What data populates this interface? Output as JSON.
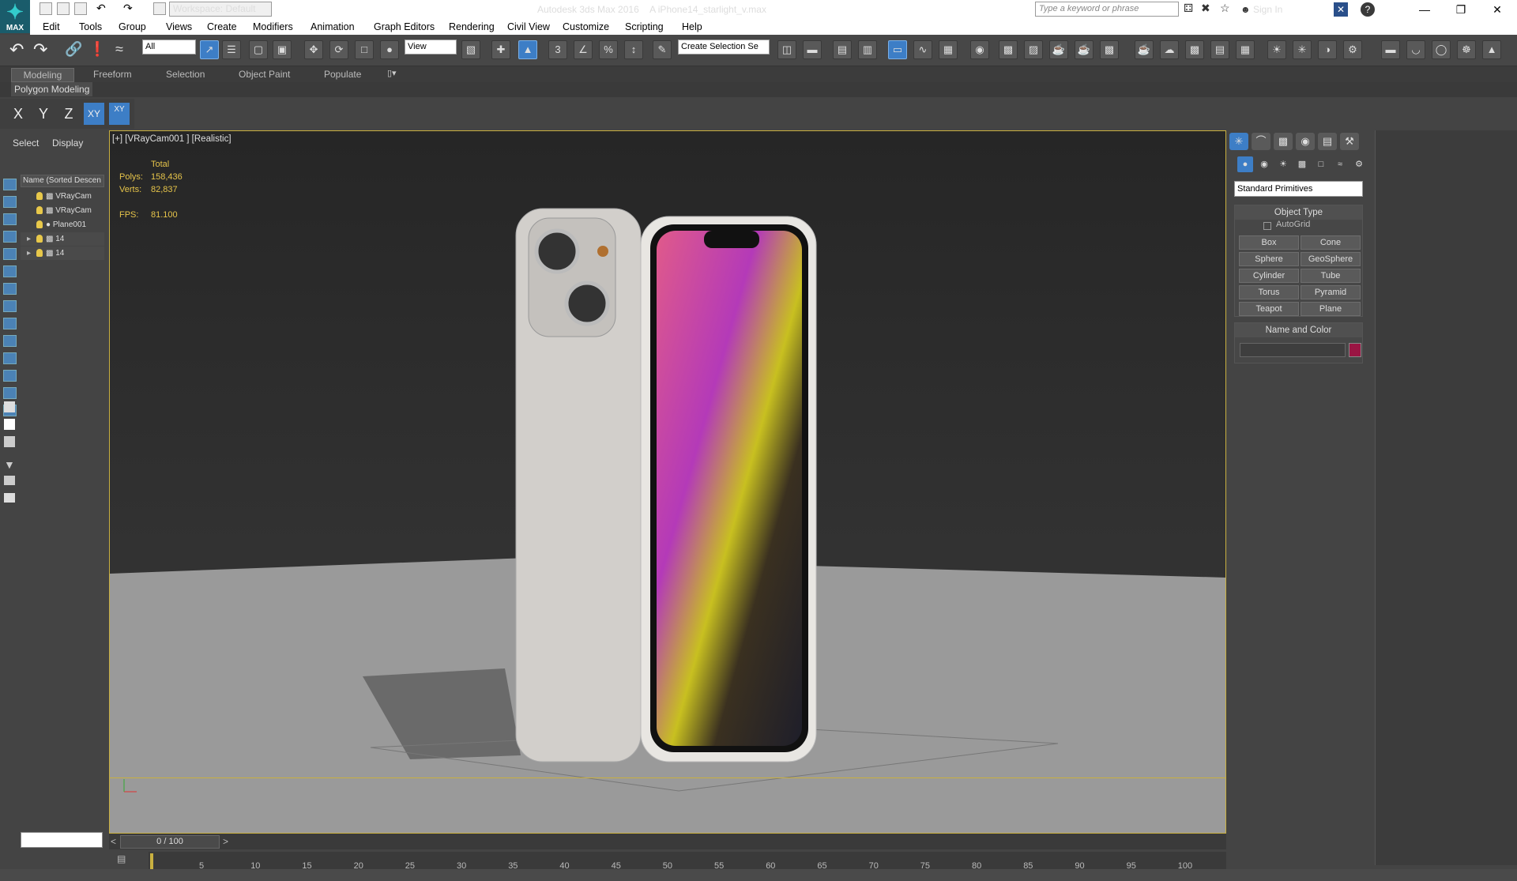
{
  "titlebar": {
    "logo_label": "MAX",
    "workspace": "Workspace: Default",
    "window_title": "Autodesk 3ds Max 2016",
    "file_name": "A iPhone14_starlight_v.max",
    "search_placeholder": "Type a keyword or phrase",
    "sign_in": "Sign In"
  },
  "menu": [
    "Edit",
    "Tools",
    "Group",
    "Views",
    "Create",
    "Modifiers",
    "Animation",
    "Graph Editors",
    "Rendering",
    "Civil View",
    "Customize",
    "Scripting",
    "Help"
  ],
  "toolbar": {
    "selection_filter": "All",
    "ref_coord": "View",
    "named_selection": "Create Selection Se"
  },
  "ribbon": {
    "tabs": [
      "Modeling",
      "Freeform",
      "Selection",
      "Object Paint",
      "Populate"
    ],
    "panel": "Polygon Modeling"
  },
  "axis_constraints": [
    "X",
    "Y",
    "Z",
    "XY",
    "XY"
  ],
  "explorer": {
    "tabs": [
      "Select",
      "Display"
    ],
    "column": "Name (Sorted Descen",
    "rows": [
      "VRayCam",
      "VRayCam",
      "Plane001",
      "14",
      "14"
    ]
  },
  "viewport": {
    "label": "[+] [VRayCam001 ] [Realistic]",
    "stats_header": "Total",
    "polys_label": "Polys:",
    "polys_value": "158,436",
    "verts_label": "Verts:",
    "verts_value": "82,837",
    "fps_label": "FPS:",
    "fps_value": "81.100"
  },
  "command_panel": {
    "primitive_type": "Standard Primitives",
    "object_type": "Object Type",
    "autogrid": "AutoGrid",
    "buttons": [
      "Box",
      "Cone",
      "Sphere",
      "GeoSphere",
      "Cylinder",
      "Tube",
      "Torus",
      "Pyramid",
      "Teapot",
      "Plane"
    ],
    "name_color": "Name and Color",
    "color_swatch": "#9a1543"
  },
  "timeline": {
    "frame_display": "0 / 100",
    "ticks": [
      "5",
      "10",
      "15",
      "20",
      "25",
      "30",
      "35",
      "40",
      "45",
      "50",
      "55",
      "60",
      "65",
      "70",
      "75",
      "80",
      "85",
      "90",
      "95",
      "100"
    ]
  }
}
